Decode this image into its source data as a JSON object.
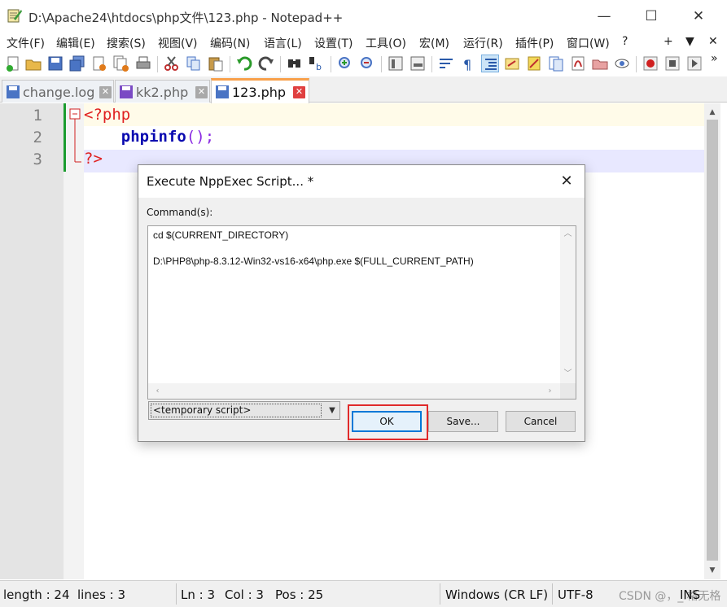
{
  "window": {
    "title": "D:\\Apache24\\htdocs\\php文件\\123.php - Notepad++",
    "minimize": "—",
    "maximize": "☐",
    "close": "✕"
  },
  "menu": {
    "items": [
      "文件(F)",
      "编辑(E)",
      "搜索(S)",
      "视图(V)",
      "编码(N)",
      "语言(L)",
      "设置(T)",
      "工具(O)",
      "宏(M)",
      "运行(R)",
      "插件(P)",
      "窗口(W)",
      "?"
    ],
    "right": [
      "+",
      "▼",
      "✕"
    ]
  },
  "toolbar": {
    "icons": [
      "new-file-icon",
      "open-file-icon",
      "save-icon",
      "save-all-icon",
      "close-icon",
      "close-all-icon",
      "print-icon",
      "cut-icon",
      "copy-icon",
      "paste-icon",
      "undo-icon",
      "redo-icon",
      "find-icon",
      "replace-icon",
      "zoom-in-icon",
      "zoom-out-icon",
      "sync-v-icon",
      "sync-h-icon",
      "word-wrap-icon",
      "show-all-chars-icon",
      "indent-guide-icon",
      "lang-icon",
      "doc-map-icon",
      "func-list-icon",
      "folder-workspace-icon",
      "monitor-icon",
      "record-macro-icon",
      "stop-macro-icon",
      "play-macro-icon"
    ],
    "overflow": "»"
  },
  "tabs": [
    {
      "label": "change.log",
      "active": false
    },
    {
      "label": "kk2.php",
      "active": false
    },
    {
      "label": "123.php",
      "active": true
    }
  ],
  "editor": {
    "line_numbers": [
      "1",
      "2",
      "3"
    ],
    "lines": [
      {
        "tokens": [
          {
            "t": "<?php",
            "c": "tag"
          }
        ]
      },
      {
        "tokens": [
          {
            "t": "    ",
            "c": "ws"
          },
          {
            "t": "phpinfo",
            "c": "fn"
          },
          {
            "t": "();",
            "c": "punct"
          }
        ]
      },
      {
        "tokens": [
          {
            "t": "?>",
            "c": "tag"
          }
        ]
      }
    ]
  },
  "status": {
    "length": "length : 24",
    "lines": "lines : 3",
    "ln": "Ln : 3",
    "col": "Col : 3",
    "pos": "Pos : 25",
    "eol": "Windows (CR LF)",
    "encoding": "UTF-8",
    "mode": "INS",
    "watermark": "CSDN @，_I格无格"
  },
  "dialog": {
    "title": "Execute NppExec Script... *",
    "close": "✕",
    "commands_label": "Command(s):",
    "commands": [
      "cd $(CURRENT_DIRECTORY)",
      "",
      "D:\\PHP8\\php-8.3.12-Win32-vs16-x64\\php.exe $(FULL_CURRENT_PATH)"
    ],
    "script_select_value": "<temporary script>",
    "buttons": {
      "ok": "OK",
      "save": "Save...",
      "cancel": "Cancel"
    },
    "highlight_color": "#e02a2a"
  }
}
